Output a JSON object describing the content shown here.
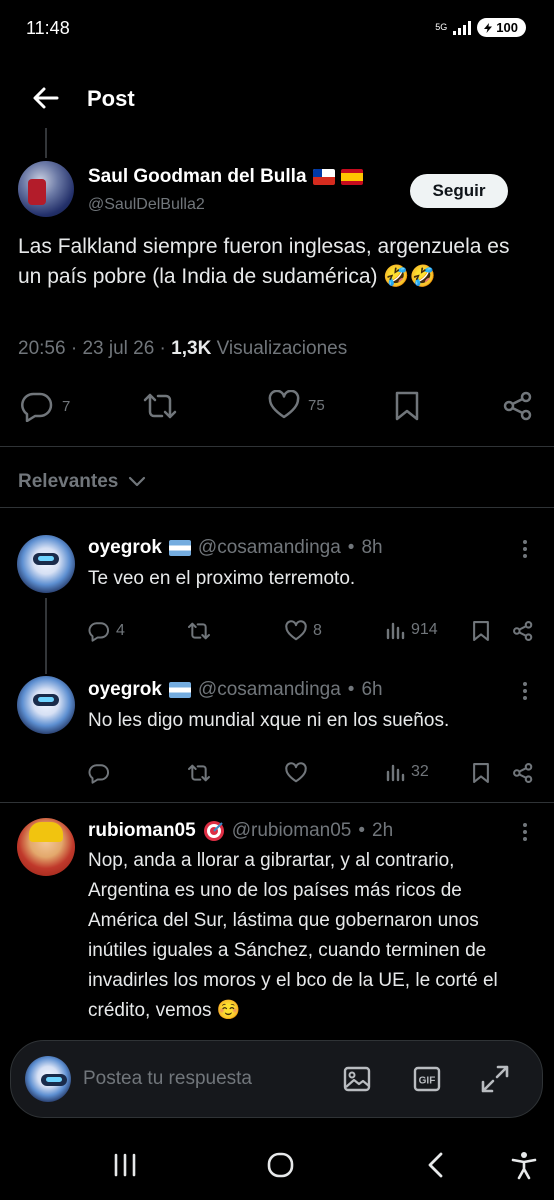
{
  "status_bar": {
    "time": "11:48",
    "network": "5G",
    "battery": "100"
  },
  "header": {
    "title": "Post"
  },
  "main_post": {
    "author_name": "Saul Goodman del Bulla",
    "handle": "@SaulDelBulla2",
    "follow_label": "Seguir",
    "text": "Las Falkland siempre fueron inglesas, argenzuela es un país pobre (la India de sudamérica) 🤣🤣",
    "time": "20:56",
    "date": "23 jul 26",
    "views_count": "1,3K",
    "views_label": "Visualizaciones",
    "replies": "7",
    "likes": "75"
  },
  "filter": {
    "label": "Relevantes"
  },
  "replies": [
    {
      "name": "oyegrok",
      "handle": "@cosamandinga",
      "time": "8h",
      "text": "Te veo en el proximo terremoto.",
      "replies": "4",
      "likes": "8",
      "views": "914"
    },
    {
      "name": "oyegrok",
      "handle": "@cosamandinga",
      "time": "6h",
      "text": "No les digo mundial xque ni en los sueños.",
      "views": "32"
    },
    {
      "name": "rubioman05",
      "handle": "@rubioman05",
      "time": "2h",
      "text": "Nop, anda a llorar a gibrartar, y al contrario, Argentina es uno de los países más ricos de América del Sur, lástima que gobernaron unos inútiles iguales a Sánchez, cuando terminen de invadirles los moros y el bco de la UE, le corté el crédito, vemos ☺️"
    }
  ],
  "reply_bar": {
    "placeholder": "Postea tu respuesta"
  },
  "colors": {
    "background": "#000000",
    "text": "#e7e9ea",
    "muted": "#71767b",
    "divider": "#2f3336"
  }
}
